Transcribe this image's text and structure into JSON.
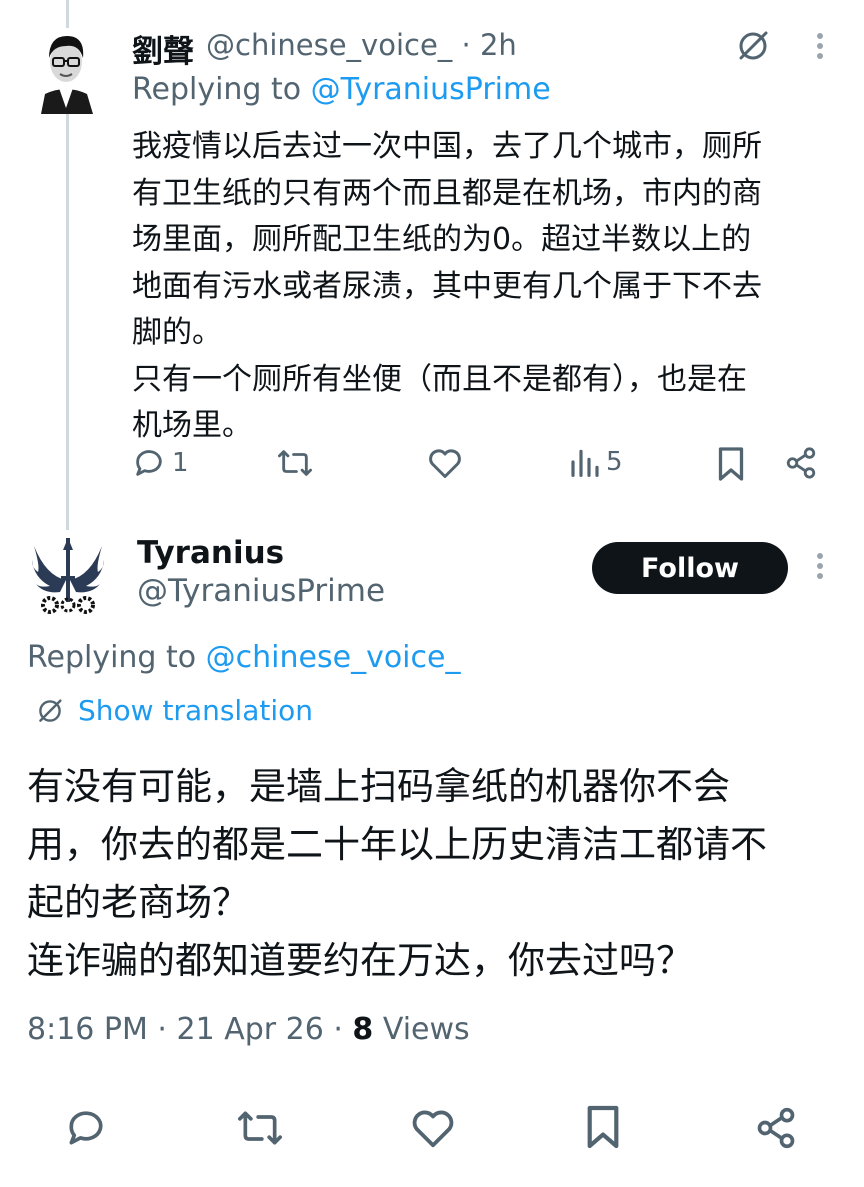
{
  "reply_parent": {
    "author_name": "劉聲",
    "author_handle": "@chinese_voice_",
    "time": " · 2h",
    "replying_prefix": "Replying to ",
    "replying_handle": "@TyraniusPrime",
    "body": "我疫情以后去过一次中国，去了几个城市，厕所\n有卫生纸的只有两个而且都是在机场，市内的商\n场里面，厕所配卫生纸的为0。超过半数以上的\n地面有污水或者尿渍，其中更有几个属于下不去\n脚的。\n只有一个厕所有坐便（而且不是都有），也是在\n机场里。",
    "counts": {
      "replies": "1",
      "views": "5"
    }
  },
  "main_tweet": {
    "author_name": "Tyranius",
    "author_handle": "@TyraniusPrime",
    "follow_label": "Follow",
    "replying_prefix": "Replying to ",
    "replying_handle": "@chinese_voice_",
    "show_translation": "Show translation",
    "body": "有没有可能，是墙上扫码拿纸的机器你不会\n用，你去的都是二十年以上历史清洁工都请不\n起的老商场？\n连诈骗的都知道要约在万达，你去过吗？",
    "time": "8:16 PM · 21 Apr 26 · ",
    "views_count": "8",
    "views_label": " Views"
  },
  "colors": {
    "accent": "#1d9bf0",
    "muted": "#536471",
    "text": "#0f1419"
  },
  "icons": [
    "grok-translate-icon",
    "more-icon",
    "reply-icon",
    "retweet-icon",
    "like-icon",
    "views-icon",
    "bookmark-icon",
    "share-icon"
  ]
}
